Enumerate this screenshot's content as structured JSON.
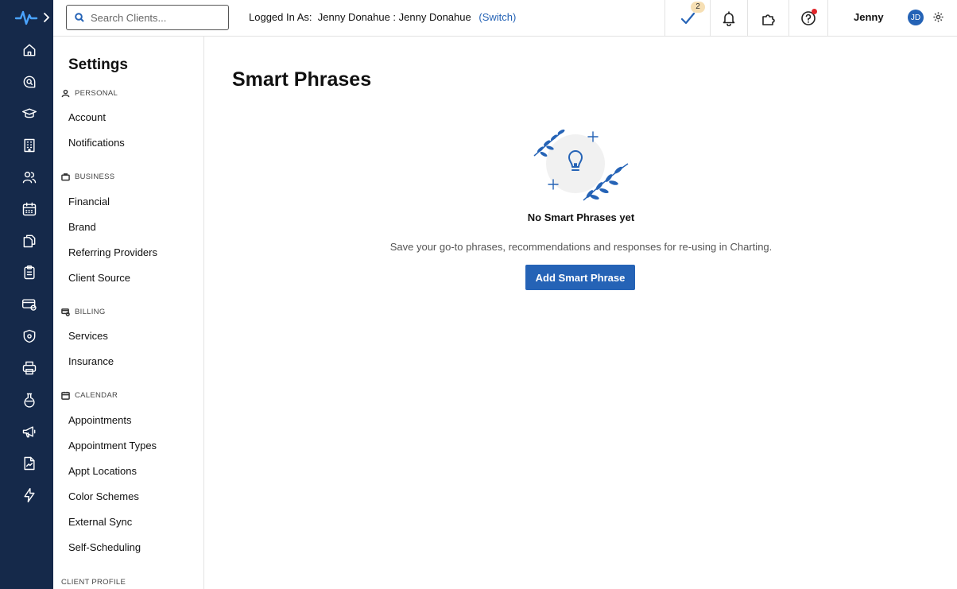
{
  "rail": {
    "icons": [
      "logo-icon",
      "expand-chevron-icon",
      "home-icon",
      "search-chat-icon",
      "graduation-cap-icon",
      "building-icon",
      "users-icon",
      "calendar-icon",
      "documents-icon",
      "clipboard-icon",
      "billing-icon",
      "shield-icon",
      "printer-icon",
      "flask-icon",
      "megaphone-icon",
      "report-icon",
      "lightning-icon"
    ]
  },
  "topbar": {
    "search_placeholder": "Search Clients...",
    "logged_in_label": "Logged In As:",
    "logged_in_user": "Jenny Donahue : Jenny Donahue",
    "switch_label": "(Switch)",
    "tasks_count": "2",
    "user_name": "Jenny",
    "user_initials": "JD"
  },
  "sidebar": {
    "title": "Settings",
    "sections": {
      "personal": {
        "label": "PERSONAL",
        "items": [
          "Account",
          "Notifications"
        ]
      },
      "business": {
        "label": "BUSINESS",
        "items": [
          "Financial",
          "Brand",
          "Referring Providers",
          "Client Source"
        ]
      },
      "billing": {
        "label": "BILLING",
        "items": [
          "Services",
          "Insurance"
        ]
      },
      "calendar": {
        "label": "CALENDAR",
        "items": [
          "Appointments",
          "Appointment Types",
          "Appt Locations",
          "Color Schemes",
          "External Sync",
          "Self-Scheduling"
        ]
      },
      "client_profile": {
        "label": "CLIENT PROFILE"
      }
    }
  },
  "main": {
    "title": "Smart Phrases",
    "empty_title": "No Smart Phrases yet",
    "empty_desc": "Save your go-to phrases, recommendations and responses for re-using in Charting.",
    "add_button": "Add Smart Phrase"
  },
  "colors": {
    "rail": "#15294a",
    "accent": "#2563b6",
    "badge": "#f6dfb4",
    "alert": "#e0262b"
  }
}
